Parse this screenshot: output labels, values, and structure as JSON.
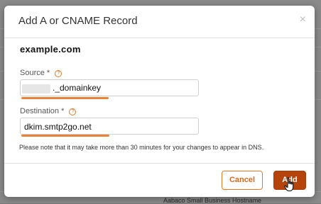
{
  "background": {
    "bottom_text": "Aabaco Small Business Hostname"
  },
  "dialog": {
    "title": "Add A or CNAME Record",
    "close_icon": "×",
    "domain": "example.com",
    "source": {
      "label": "Source *",
      "value": "._domainkey"
    },
    "destination": {
      "label": "Destination *",
      "value": "dkim.smtp2go.net"
    },
    "help_icon": "?",
    "note": "Please note that it may take more than 30 minutes for your changes to appear in DNS.",
    "cancel_label": "Cancel",
    "add_label": "Add"
  },
  "colors": {
    "accent": "#e8823a",
    "primary_button": "#b5430c"
  }
}
